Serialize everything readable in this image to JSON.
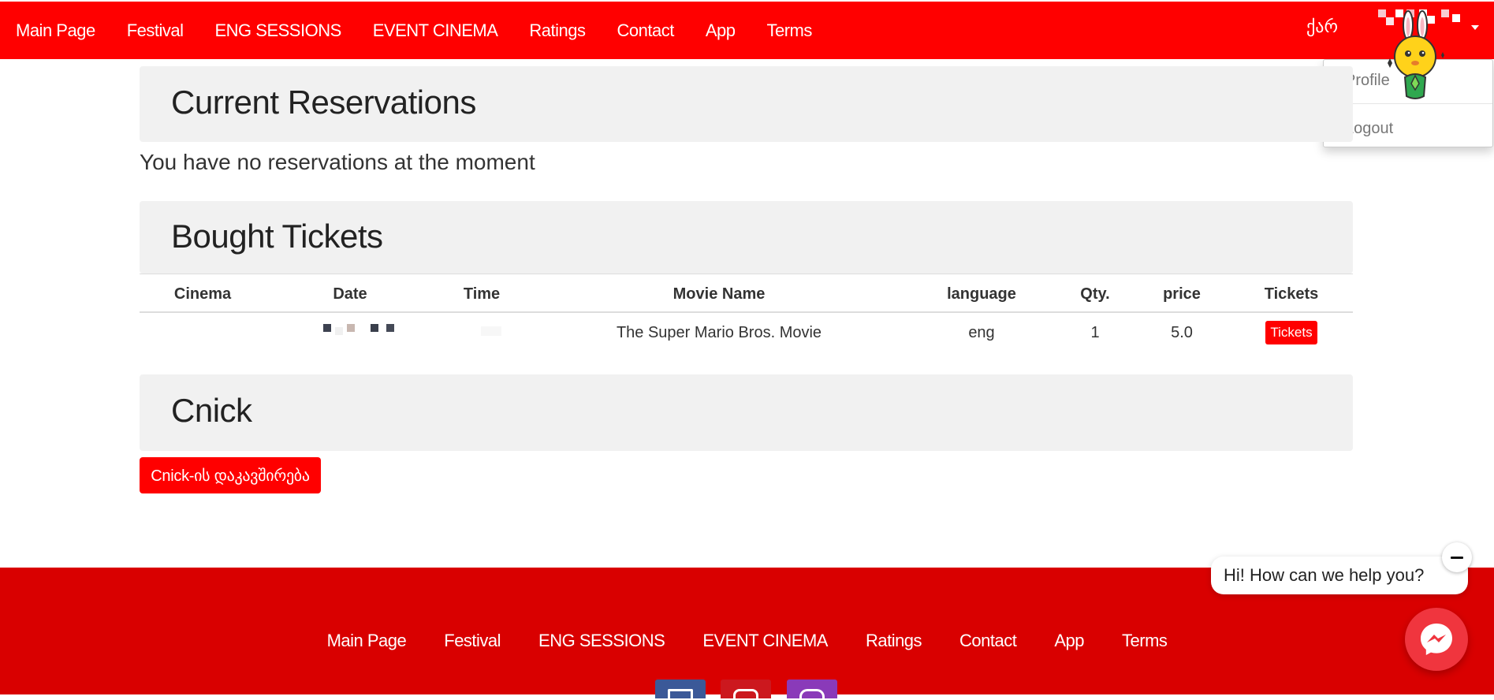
{
  "nav": {
    "items": [
      "Main Page",
      "Festival",
      "ENG SESSIONS",
      "EVENT CINEMA",
      "Ratings",
      "Contact",
      "App",
      "Terms"
    ],
    "language": "ქარ"
  },
  "user_menu": {
    "profile": "Profile",
    "logout": "Logout"
  },
  "reservations": {
    "title": "Current Reservations",
    "empty_message": "You have no reservations at the moment"
  },
  "bought_tickets": {
    "title": "Bought Tickets",
    "columns": [
      "Cinema",
      "Date",
      "Time",
      "Movie Name",
      "language",
      "Qty.",
      "price",
      "Tickets"
    ],
    "rows": [
      {
        "cinema": "",
        "movie_name": "The Super Mario Bros. Movie",
        "language": "eng",
        "qty": "1",
        "price": "5.0",
        "tickets_label": "Tickets"
      }
    ]
  },
  "cnick": {
    "title": "Cnick",
    "connect_label": "Cnick-ის დაკავშირება"
  },
  "footer": {
    "items": [
      "Main Page",
      "Festival",
      "ENG SESSIONS",
      "EVENT CINEMA",
      "Ratings",
      "Contact",
      "App",
      "Terms"
    ],
    "social": [
      "facebook-icon",
      "youtube-icon",
      "instagram-icon"
    ]
  },
  "chat": {
    "greeting": "Hi! How can we help you?"
  },
  "colors": {
    "brand_red": "#ff0000",
    "footer_red": "#d90000",
    "messenger_red": "#f0353e",
    "facebook_blue": "#3b5998",
    "youtube_red": "#cc181e",
    "instagram_purple": "#8a3ab9"
  }
}
